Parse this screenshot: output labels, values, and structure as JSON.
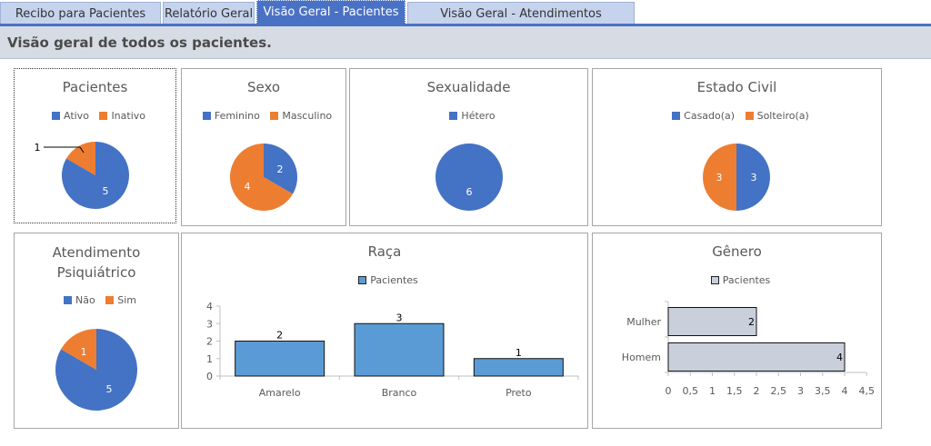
{
  "tabs": [
    {
      "label": "Recibo para Pacientes",
      "active": false
    },
    {
      "label": "Relatório Geral",
      "active": false
    },
    {
      "label": "Visão Geral - Pacientes",
      "active": true
    },
    {
      "label": "Visão Geral - Atendimentos",
      "active": false
    }
  ],
  "header": {
    "title": "Visão geral de todos os pacientes."
  },
  "colors": {
    "blue": "#4472c4",
    "orange": "#ed7d31",
    "bar_blue": "#5b9bd5",
    "bar_gray": "#c9d0db"
  },
  "charts": {
    "pacientes": {
      "title": "Pacientes",
      "legend": [
        "Ativo",
        "Inativo"
      ],
      "values": [
        5,
        1
      ],
      "labels": [
        "5",
        "1"
      ]
    },
    "sexo": {
      "title": "Sexo",
      "legend": [
        "Feminino",
        "Masculino"
      ],
      "values": [
        2,
        4
      ],
      "labels": [
        "2",
        "4"
      ]
    },
    "sexualidade": {
      "title": "Sexualidade",
      "legend": [
        "Hétero"
      ],
      "values": [
        6
      ],
      "labels": [
        "6"
      ]
    },
    "estado_civil": {
      "title": "Estado Civil",
      "legend": [
        "Casado(a)",
        "Solteiro(a)"
      ],
      "values": [
        3,
        3
      ],
      "labels": [
        "3",
        "3"
      ]
    },
    "atendimento": {
      "title_line1": "Atendimento",
      "title_line2": "Psiquiátrico",
      "legend": [
        "Não",
        "Sim"
      ],
      "values": [
        5,
        1
      ],
      "labels": [
        "5",
        "1"
      ]
    },
    "raca": {
      "title": "Raça",
      "legend": "Pacientes",
      "categories": [
        "Amarelo",
        "Branco",
        "Preto"
      ],
      "values": [
        2,
        3,
        1
      ],
      "value_labels": [
        "2",
        "3",
        "1"
      ],
      "yticks": [
        "0",
        "1",
        "2",
        "3",
        "4"
      ]
    },
    "genero": {
      "title": "Gênero",
      "legend": "Pacientes",
      "categories": [
        "Mulher",
        "Homem"
      ],
      "values": [
        2,
        4
      ],
      "value_labels": [
        "2",
        "4"
      ],
      "xticks": [
        "0",
        "0,5",
        "1",
        "1,5",
        "2",
        "2,5",
        "3",
        "3,5",
        "4",
        "4,5"
      ]
    }
  },
  "chart_data": [
    {
      "type": "pie",
      "title": "Pacientes",
      "categories": [
        "Ativo",
        "Inativo"
      ],
      "values": [
        5,
        1
      ]
    },
    {
      "type": "pie",
      "title": "Sexo",
      "categories": [
        "Feminino",
        "Masculino"
      ],
      "values": [
        2,
        4
      ]
    },
    {
      "type": "pie",
      "title": "Sexualidade",
      "categories": [
        "Hétero"
      ],
      "values": [
        6
      ]
    },
    {
      "type": "pie",
      "title": "Estado Civil",
      "categories": [
        "Casado(a)",
        "Solteiro(a)"
      ],
      "values": [
        3,
        3
      ]
    },
    {
      "type": "pie",
      "title": "Atendimento Psiquiátrico",
      "categories": [
        "Não",
        "Sim"
      ],
      "values": [
        5,
        1
      ]
    },
    {
      "type": "bar",
      "title": "Raça",
      "categories": [
        "Amarelo",
        "Branco",
        "Preto"
      ],
      "series": [
        {
          "name": "Pacientes",
          "values": [
            2,
            3,
            1
          ]
        }
      ],
      "ylim": [
        0,
        4
      ]
    },
    {
      "type": "bar",
      "title": "Gênero",
      "orientation": "horizontal",
      "categories": [
        "Mulher",
        "Homem"
      ],
      "series": [
        {
          "name": "Pacientes",
          "values": [
            2,
            4
          ]
        }
      ],
      "xlim": [
        0,
        4.5
      ]
    }
  ]
}
